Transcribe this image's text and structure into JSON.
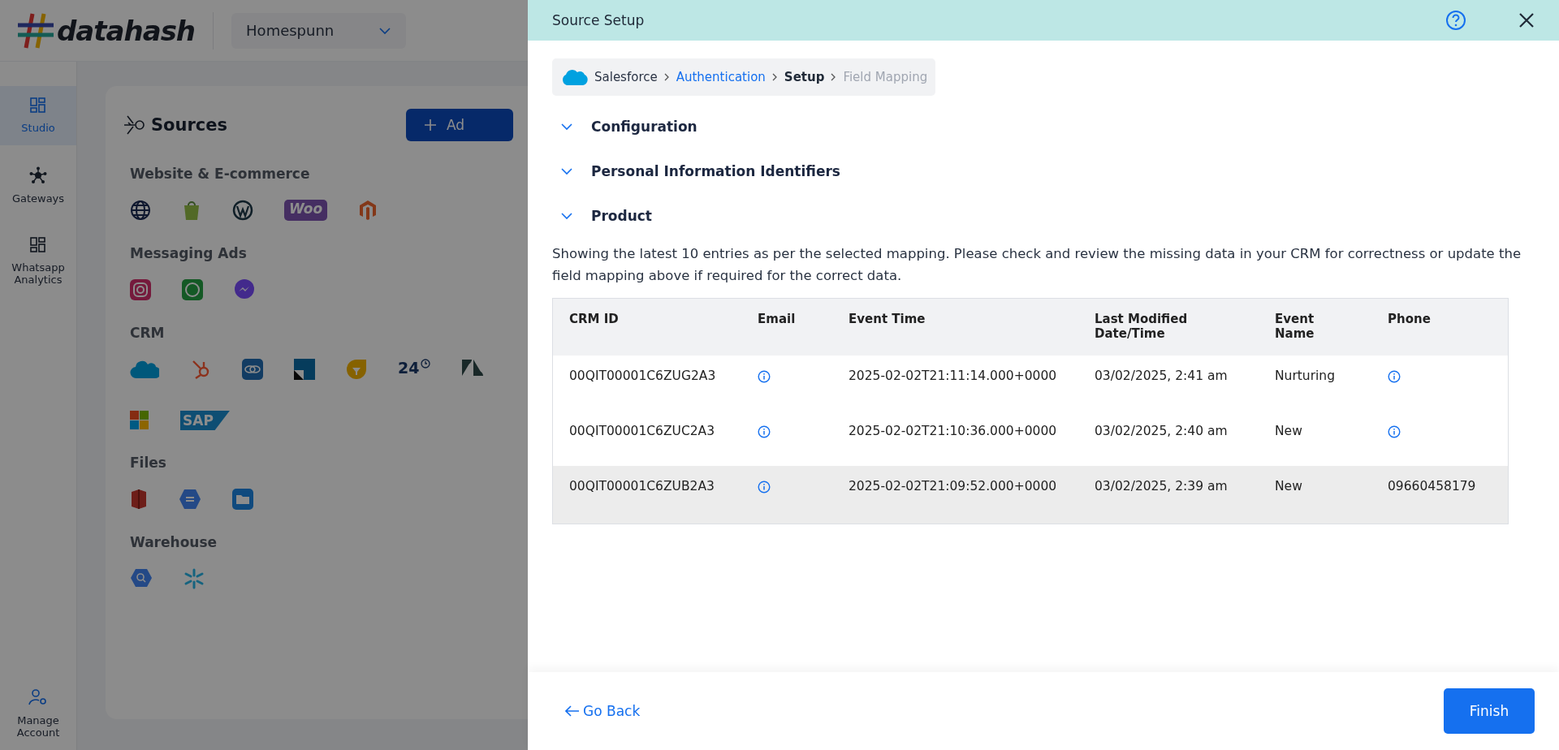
{
  "app": {
    "logo": "datahash",
    "workspace": "Homespunn"
  },
  "sidebar": {
    "items": [
      {
        "label": "Studio",
        "kind": "grid",
        "selected": true
      },
      {
        "label": "Gateways",
        "kind": "hub",
        "selected": false
      },
      {
        "label": "Whatsapp Analytics",
        "kind": "grid",
        "selected": false
      }
    ],
    "footer": {
      "label": "Manage Account"
    }
  },
  "sources": {
    "title": "Sources",
    "add_button": "Ad",
    "groups": [
      {
        "title": "Website & E-commerce",
        "icons": [
          {
            "kind": "globe"
          },
          {
            "kind": "bag"
          },
          {
            "kind": "wp"
          },
          {
            "kind": "woo",
            "text": "Woo"
          },
          {
            "kind": "magento"
          }
        ]
      },
      {
        "title": "Messaging Ads",
        "icons": [
          {
            "kind": "camera"
          },
          {
            "kind": "phone"
          },
          {
            "kind": "messenger"
          }
        ]
      },
      {
        "title": "CRM",
        "icons": [
          {
            "kind": "cloud"
          },
          {
            "kind": "sprocket"
          },
          {
            "kind": "rings"
          },
          {
            "kind": "square"
          },
          {
            "kind": "drop"
          },
          {
            "kind": "clock24",
            "text": "24"
          },
          {
            "kind": "zigzag"
          },
          {
            "kind": "windows"
          },
          {
            "kind": "sap",
            "text": "SAP"
          }
        ]
      },
      {
        "title": "Files",
        "icons": [
          {
            "kind": "bucket"
          },
          {
            "kind": "hexagon"
          },
          {
            "kind": "folder"
          }
        ]
      },
      {
        "title": "Warehouse",
        "icons": [
          {
            "kind": "hexsearch"
          },
          {
            "kind": "snowflake"
          }
        ]
      }
    ]
  },
  "drawer": {
    "title": "Source Setup",
    "breadcrumb": [
      {
        "label": "Salesforce",
        "kind": "done"
      },
      {
        "label": "Authentication",
        "kind": "link"
      },
      {
        "label": "Setup",
        "kind": "current"
      },
      {
        "label": "Field Mapping",
        "kind": "upcoming"
      }
    ],
    "sections": [
      {
        "title": "Configuration"
      },
      {
        "title": "Personal Information Identifiers"
      },
      {
        "title": "Product"
      }
    ],
    "note": "Showing the latest 10 entries as per the selected mapping. Please check and review the missing data in your CRM for correctness or update the field mapping above if required for the correct data.",
    "table": {
      "columns": [
        "CRM ID",
        "Email",
        "Event Time",
        "Last Modified Date/Time",
        "Event Name",
        "Phone"
      ],
      "rows": [
        {
          "highlighted": false,
          "cells": [
            {
              "kind": "text",
              "text": "00QIT00001C6ZUG2A3"
            },
            {
              "kind": "missing"
            },
            {
              "kind": "text",
              "text": "2025-02-02T21:11:14.000+0000"
            },
            {
              "kind": "text",
              "text": "03/02/2025, 2:41 am"
            },
            {
              "kind": "text",
              "text": "Nurturing"
            },
            {
              "kind": "missing"
            }
          ]
        },
        {
          "highlighted": false,
          "cells": [
            {
              "kind": "text",
              "text": "00QIT00001C6ZUC2A3"
            },
            {
              "kind": "missing"
            },
            {
              "kind": "text",
              "text": "2025-02-02T21:10:36.000+0000"
            },
            {
              "kind": "text",
              "text": "03/02/2025, 2:40 am"
            },
            {
              "kind": "text",
              "text": "New"
            },
            {
              "kind": "missing"
            }
          ]
        },
        {
          "highlighted": true,
          "cells": [
            {
              "kind": "text",
              "text": "00QIT00001C6ZUB2A3"
            },
            {
              "kind": "missing"
            },
            {
              "kind": "text",
              "text": "2025-02-02T21:09:52.000+0000"
            },
            {
              "kind": "text",
              "text": "03/02/2025, 2:39 am"
            },
            {
              "kind": "text",
              "text": "New"
            },
            {
              "kind": "text",
              "text": "09660458179"
            }
          ]
        }
      ]
    },
    "back_button": "Go Back",
    "finish_button": "Finish"
  }
}
